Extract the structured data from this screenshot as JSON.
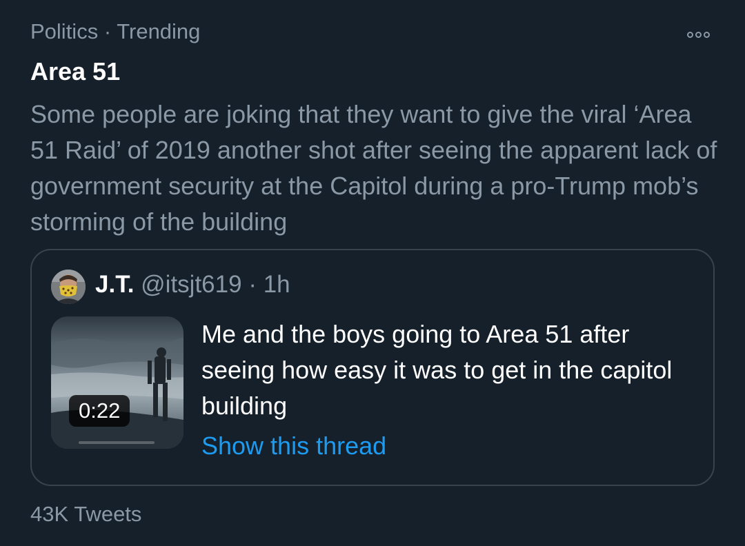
{
  "trend": {
    "category": "Politics",
    "separator": "·",
    "status": "Trending",
    "title": "Area 51",
    "description": "Some people are joking that they want to give the viral ‘Area 51 Raid’ of 2019 another shot after seeing the apparent lack of government security at the Capitol during a pro-Trump mob’s storming of the building",
    "more_icon": "more-options-icon",
    "tweet_count": "43K Tweets"
  },
  "quoted_tweet": {
    "author_name": "J.T.",
    "handle": "@itsjt619",
    "separator": "·",
    "time": "1h",
    "text": "Me and the boys going to Area 51 after seeing how easy it was to get in the capitol building",
    "show_thread_label": "Show this thread",
    "video": {
      "duration": "0:22",
      "progress": 0.0
    }
  },
  "colors": {
    "background": "#15202b",
    "primary_text": "#ffffff",
    "secondary_text": "#8b98a5",
    "accent": "#1d9bf0",
    "border": "#38444d"
  }
}
